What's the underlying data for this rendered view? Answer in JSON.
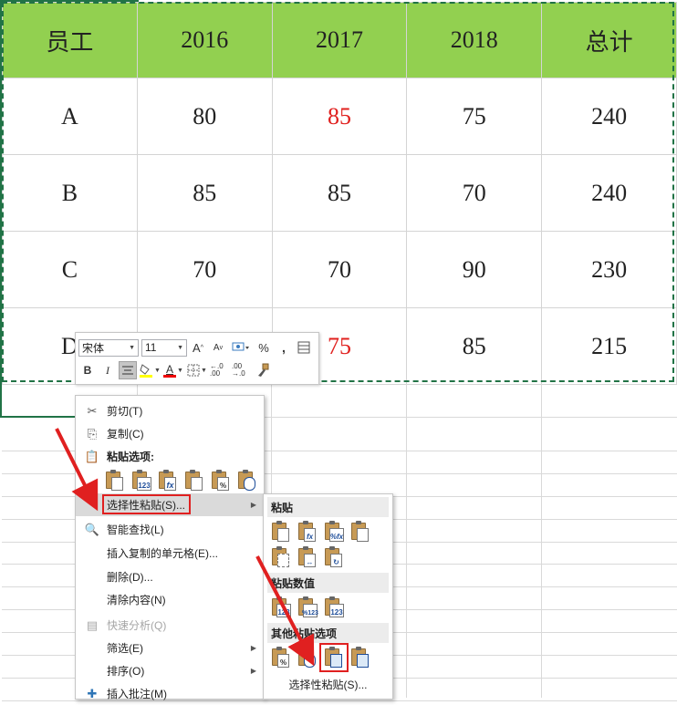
{
  "table": {
    "headers": [
      "员工",
      "2016",
      "2017",
      "2018",
      "总计"
    ],
    "rows": [
      [
        "A",
        "80",
        "85",
        "75",
        "240"
      ],
      [
        "B",
        "85",
        "85",
        "70",
        "240"
      ],
      [
        "C",
        "70",
        "70",
        "90",
        "230"
      ],
      [
        "D",
        "",
        "75",
        "85",
        "215"
      ]
    ],
    "header_color": "#92d050",
    "highlight_color": "#e0201e"
  },
  "minibar": {
    "font_name": "宋体",
    "font_size": "11",
    "grow_font": "A",
    "shrink_font": "A",
    "percent": "%",
    "comma": ",",
    "bold": "B",
    "italic": "I",
    "font_color_letter": "A",
    "dec_more": "←.0 .00",
    "dec_less": ".00 →.0"
  },
  "context_menu": {
    "cut": "剪切(T)",
    "copy": "复制(C)",
    "paste_options_header": "粘贴选项:",
    "paste_special": "选择性粘贴(S)...",
    "smart_lookup": "智能查找(L)",
    "insert_copied": "插入复制的单元格(E)...",
    "delete": "删除(D)...",
    "clear": "清除内容(N)",
    "quick_analysis": "快速分析(Q)",
    "filter": "筛选(E)",
    "sort": "排序(O)",
    "insert_comment": "插入批注(M)",
    "paste_labels": [
      "",
      "123",
      "fx",
      "",
      "%",
      ""
    ]
  },
  "submenu": {
    "paste_header": "粘贴",
    "paste_values_header": "粘贴数值",
    "other_header": "其他粘贴选项",
    "paste_special_bottom": "选择性粘贴(S)...",
    "row1_labels": [
      "",
      "fx",
      "%fx",
      ""
    ],
    "row3_labels": [
      "123",
      "%123",
      "123"
    ],
    "other_labels": [
      "%",
      "",
      "",
      ""
    ]
  }
}
